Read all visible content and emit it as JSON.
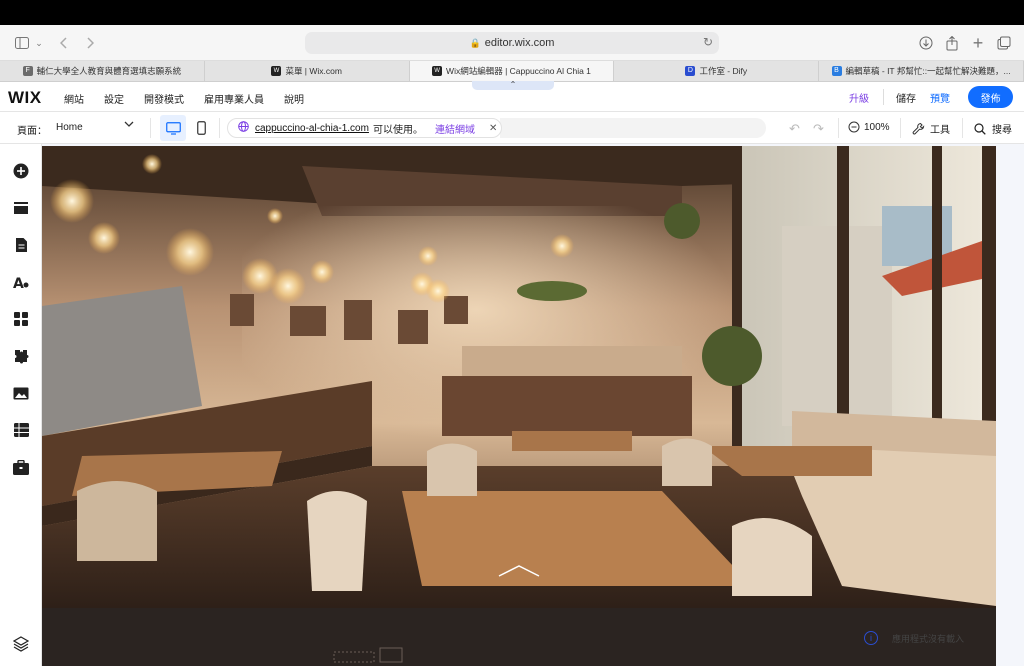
{
  "browser": {
    "url": "editor.wix.com",
    "tabs": [
      {
        "favicon": "F",
        "favicon_color": "#6b6b6b",
        "label": "輔仁大學全人教育與體育選填志願系統"
      },
      {
        "favicon": "W",
        "favicon_color": "#222222",
        "label": "菜單 | Wix.com"
      },
      {
        "favicon": "W",
        "favicon_color": "#222222",
        "label": "Wix網站編輯器 | Cappuccino Al Chia 1",
        "active": true
      },
      {
        "favicon": "D",
        "favicon_color": "#2a4dd0",
        "label": "工作室 - Dify"
      },
      {
        "favicon": "B",
        "favicon_color": "#2a7de1",
        "label": "編輯草稿 - IT 邦幫忙::一起幫忙解決難題，..."
      }
    ]
  },
  "wix": {
    "logo": "WIX",
    "menu": [
      "網站",
      "設定",
      "開發模式",
      "雇用專業人員",
      "說明"
    ],
    "upgrade": "升級",
    "save": "儲存",
    "preview": "預覽",
    "publish": "發佈"
  },
  "editor": {
    "page_label": "頁面：",
    "page_value": "Home",
    "domain": "cappuccino-al-chia-1.com",
    "domain_status": "可以使用。",
    "connect_domain": "連結網域",
    "zoom": "100%",
    "tools": "工具",
    "search": "搜尋"
  },
  "canvas": {
    "notice_text": "應用程式沒有載入"
  },
  "colors": {
    "wix_blue": "#116dff",
    "wix_purple": "#7b3fe4"
  }
}
